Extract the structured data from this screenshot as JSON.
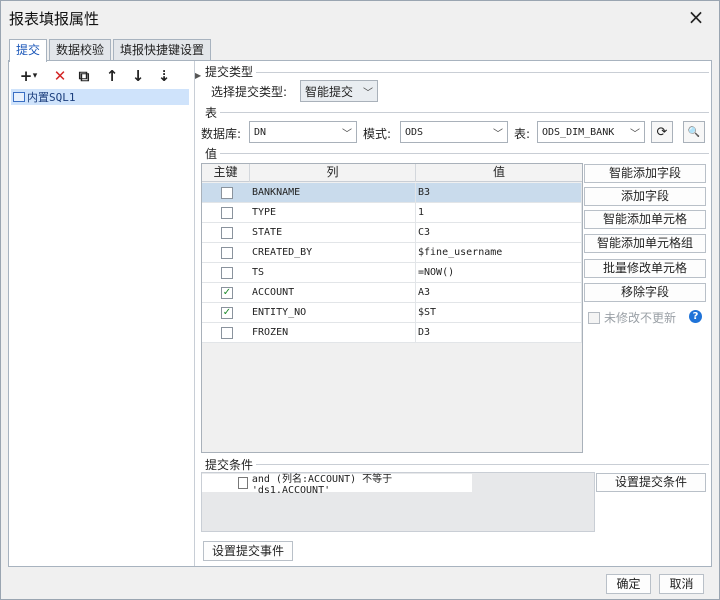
{
  "window": {
    "title": "报表填报属性",
    "close_icon": "×"
  },
  "tabs": [
    {
      "label": "提交"
    },
    {
      "label": "数据校验"
    },
    {
      "label": "填报快捷键设置"
    }
  ],
  "left": {
    "toolbar": {
      "add": "+",
      "add_dropdown": "▾",
      "delete": "✕",
      "copy": "⧉",
      "up": "↑",
      "down": "↓",
      "sort": "⇣"
    },
    "tree_item": "内置SQL1"
  },
  "submit_type": {
    "section": "提交类型",
    "label": "选择提交类型:",
    "value": "智能提交"
  },
  "table_section": {
    "section": "表",
    "db_label": "数据库:",
    "db_value": "DN",
    "schema_label": "模式:",
    "schema_value": "ODS",
    "table_label": "表:",
    "table_value": "ODS_DIM_BANK",
    "refresh_icon": "⟳",
    "search_icon": "🔍"
  },
  "values": {
    "section": "值",
    "headers": [
      "主键",
      "列",
      "值"
    ],
    "rows": [
      {
        "key": false,
        "col": "BANKNAME",
        "val": "B3"
      },
      {
        "key": false,
        "col": "TYPE",
        "val": "1"
      },
      {
        "key": false,
        "col": "STATE",
        "val": "C3"
      },
      {
        "key": false,
        "col": "CREATED_BY",
        "val": "$fine_username"
      },
      {
        "key": false,
        "col": "TS",
        "val": "=NOW()"
      },
      {
        "key": true,
        "col": "ACCOUNT",
        "val": "A3"
      },
      {
        "key": true,
        "col": "ENTITY_NO",
        "val": "$ST"
      },
      {
        "key": false,
        "col": "FROZEN",
        "val": "D3"
      }
    ]
  },
  "side_buttons": [
    "智能添加字段",
    "添加字段",
    "智能添加单元格",
    "智能添加单元格组",
    "批量修改单元格",
    "移除字段"
  ],
  "no_update": {
    "label": "未修改不更新",
    "help": "?"
  },
  "condition": {
    "section": "提交条件",
    "text": "and (列名:ACCOUNT) 不等于 'ds1.ACCOUNT'",
    "button": "设置提交条件"
  },
  "event_button": "设置提交事件",
  "footer": {
    "ok": "确定",
    "cancel": "取消"
  }
}
